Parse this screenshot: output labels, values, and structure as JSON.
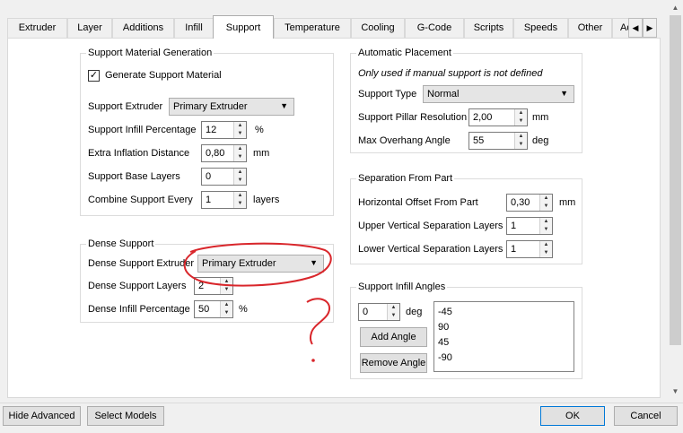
{
  "tabs": [
    "Extruder",
    "Layer",
    "Additions",
    "Infill",
    "Support",
    "Temperature",
    "Cooling",
    "G-Code",
    "Scripts",
    "Speeds",
    "Other",
    "Adv"
  ],
  "active_tab": "Support",
  "support_material_generation": {
    "title": "Support Material Generation",
    "generate_label": "Generate Support Material",
    "generate_checked": "✓",
    "extruder_label": "Support Extruder",
    "extruder_value": "Primary Extruder",
    "infill_pct_label": "Support Infill Percentage",
    "infill_pct_value": "12",
    "infill_pct_unit": "%",
    "inflation_label": "Extra Inflation Distance",
    "inflation_value": "0,80",
    "inflation_unit": "mm",
    "base_layers_label": "Support Base Layers",
    "base_layers_value": "0",
    "combine_label": "Combine Support Every",
    "combine_value": "1",
    "combine_unit": "layers"
  },
  "dense_support": {
    "title": "Dense Support",
    "extruder_label": "Dense Support Extruder",
    "extruder_value": "Primary Extruder",
    "layers_label": "Dense Support Layers",
    "layers_value": "2",
    "infill_label": "Dense Infill Percentage",
    "infill_value": "50",
    "infill_unit": "%"
  },
  "automatic_placement": {
    "title": "Automatic Placement",
    "note": "Only used if manual support is not defined",
    "type_label": "Support Type",
    "type_value": "Normal",
    "pillar_label": "Support Pillar Resolution",
    "pillar_value": "2,00",
    "pillar_unit": "mm",
    "overhang_label": "Max Overhang Angle",
    "overhang_value": "55",
    "overhang_unit": "deg"
  },
  "separation": {
    "title": "Separation From Part",
    "horizontal_label": "Horizontal Offset From Part",
    "horizontal_value": "0,30",
    "horizontal_unit": "mm",
    "upper_label": "Upper Vertical Separation Layers",
    "upper_value": "1",
    "lower_label": "Lower Vertical Separation Layers",
    "lower_value": "1"
  },
  "infill_angles": {
    "title": "Support Infill Angles",
    "angle_value": "0",
    "angle_unit": "deg",
    "add_label": "Add Angle",
    "remove_label": "Remove Angle",
    "angles": [
      "-45",
      "90",
      "45",
      "-90"
    ]
  },
  "bottom": {
    "hide_advanced": "Hide Advanced",
    "select_models": "Select Models",
    "ok": "OK",
    "cancel": "Cancel"
  },
  "annotation_color": "#d9262b"
}
